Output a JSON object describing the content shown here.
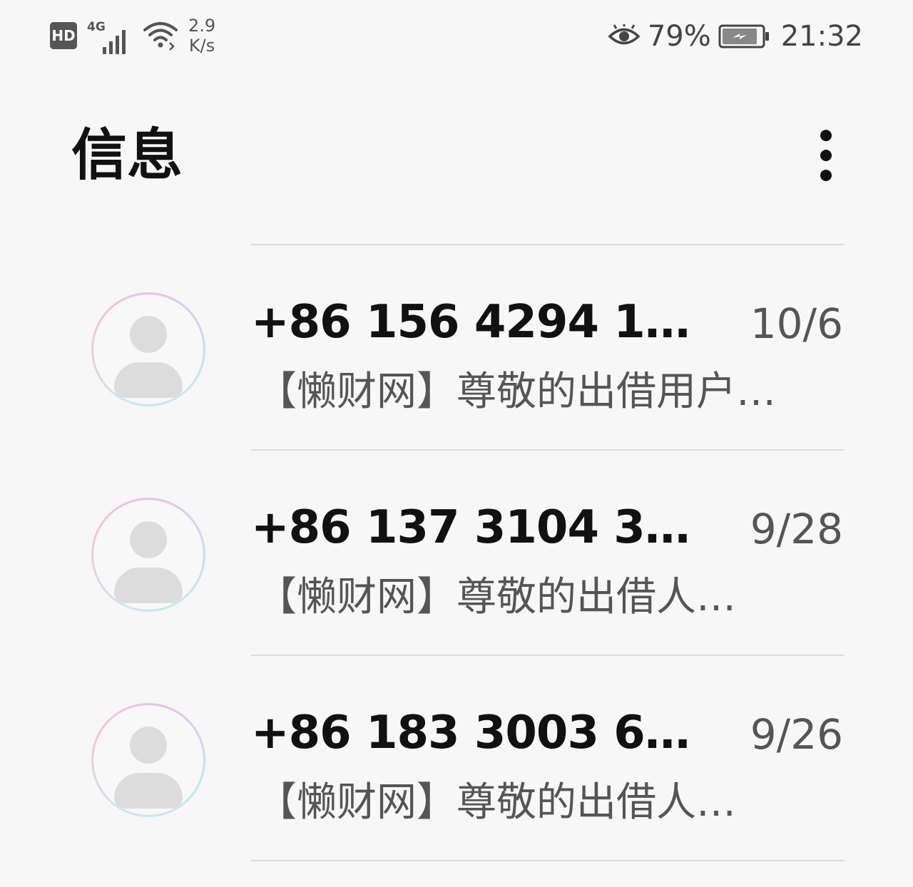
{
  "status_bar": {
    "hd_label": "HD",
    "network_type": "4G",
    "speed_value": "2.9",
    "speed_unit": "K/s",
    "battery_percent": "79%",
    "time": "21:32",
    "icons": [
      "signal-icon",
      "wifi-icon",
      "eye-icon",
      "battery-charging-icon"
    ]
  },
  "header": {
    "title": "信息",
    "menu_icon": "more-vert-icon"
  },
  "conversations": [
    {
      "sender": "+86 156 4294 1…",
      "date": "10/6",
      "preview": "【懒财网】尊敬的出借用户…"
    },
    {
      "sender": "+86 137 3104 3…",
      "date": "9/28",
      "preview": "【懒财网】尊敬的出借人…"
    },
    {
      "sender": "+86 183 3003 6…",
      "date": "9/26",
      "preview": "【懒财网】尊敬的出借人…"
    }
  ],
  "colors": {
    "background": "#f7f7f7",
    "title": "#111111",
    "secondary_text": "#555555",
    "divider": "#dcdcdc",
    "avatar_placeholder": "#dcdcdc"
  }
}
